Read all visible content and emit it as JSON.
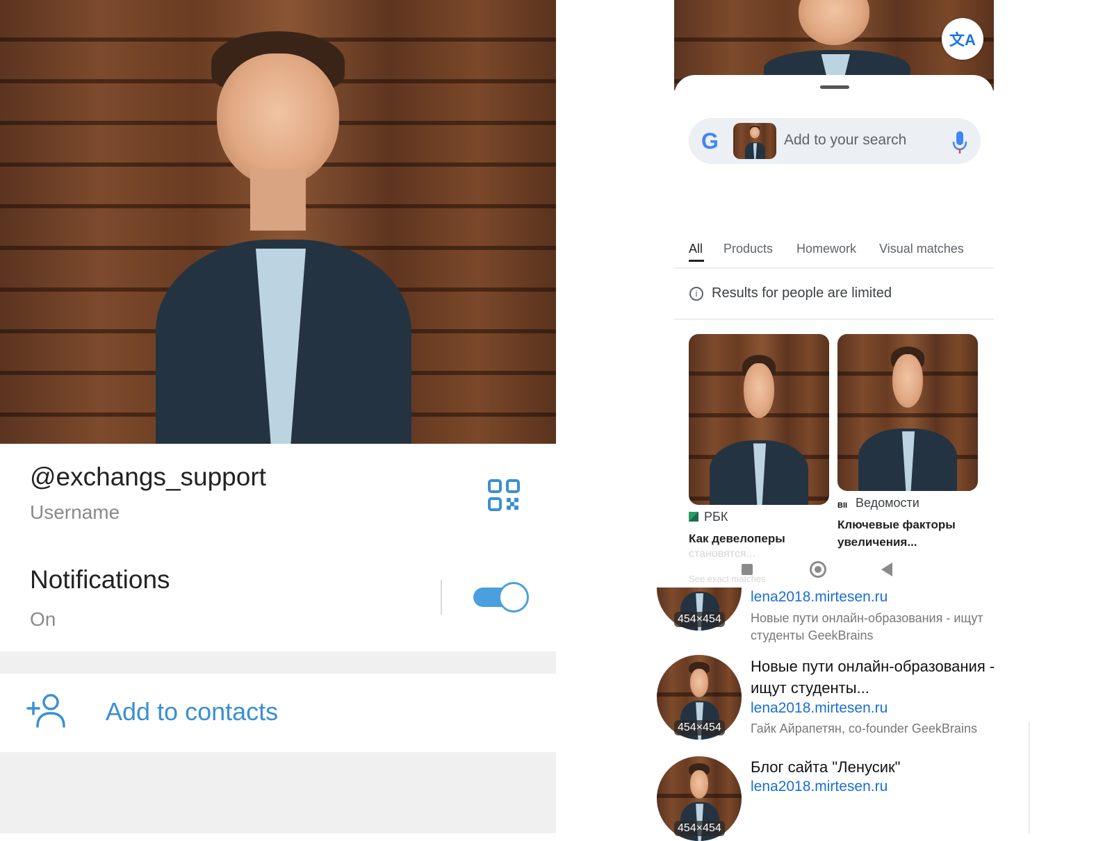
{
  "telegram": {
    "username": "@exchangs_support",
    "username_caption": "Username",
    "notifications_label": "Notifications",
    "notifications_state": "On",
    "add_contact_label": "Add to contacts",
    "accent_color": "#3a8fd4"
  },
  "lens": {
    "search_placeholder": "Add to your search",
    "google_letter": "G",
    "translate_glyph": "文A",
    "tabs": [
      "All",
      "Products",
      "Homework",
      "Visual matches"
    ],
    "notice": "Results for people are limited",
    "cards": [
      {
        "source": "РБК",
        "title": "Как девелоперы",
        "faded": "становятся...",
        "faded2": "See exact matches"
      },
      {
        "source": "Ведомости",
        "title": "Ключевые факторы увеличения..."
      }
    ]
  },
  "results": [
    {
      "size": "454×454",
      "url": "lena2018.mirtesen.ru",
      "description": "Новые пути онлайн-образования - ищут студенты GeekBrains"
    },
    {
      "size": "454×454",
      "title": "Новые пути онлайн-образования - ищут студенты...",
      "url": "lena2018.mirtesen.ru",
      "description": "Гайк Айрапетян, co-founder GeekBrains"
    },
    {
      "size": "454×454",
      "title": "Блог сайта \"Ленусик\"",
      "url": "lena2018.mirtesen.ru"
    }
  ]
}
